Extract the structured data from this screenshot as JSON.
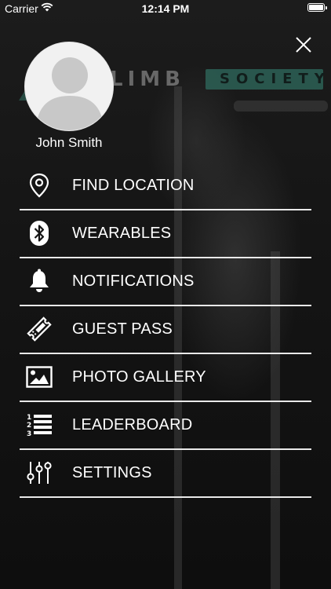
{
  "status_bar": {
    "carrier": "Carrier",
    "time": "12:14 PM"
  },
  "background": {
    "sign_left": "LIMB",
    "sign_right": "SOCIETY"
  },
  "profile": {
    "name": "John Smith"
  },
  "menu": {
    "items": [
      {
        "label": "FIND LOCATION",
        "icon": "location-pin-icon"
      },
      {
        "label": "WEARABLES",
        "icon": "bluetooth-icon"
      },
      {
        "label": "NOTIFICATIONS",
        "icon": "bell-icon"
      },
      {
        "label": "GUEST PASS",
        "icon": "ticket-icon"
      },
      {
        "label": "PHOTO GALLERY",
        "icon": "image-icon"
      },
      {
        "label": "LEADERBOARD",
        "icon": "ranked-list-icon"
      },
      {
        "label": "SETTINGS",
        "icon": "sliders-icon"
      }
    ]
  },
  "colors": {
    "text": "#ffffff",
    "divider": "#e9e9e9",
    "accent": "#2f6b5e"
  }
}
